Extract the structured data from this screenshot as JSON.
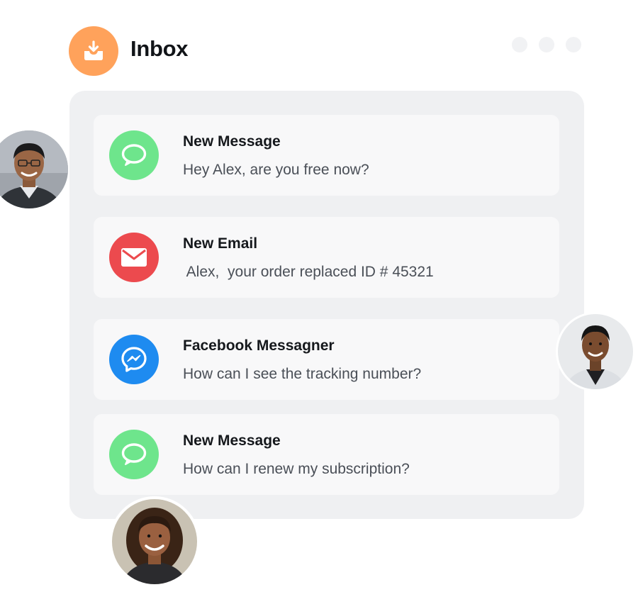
{
  "header": {
    "title": "Inbox",
    "icon": "inbox-download-icon",
    "accent": "#FFA25B"
  },
  "colors": {
    "panel_bg": "#EFF0F2",
    "card_bg": "#F8F8F9",
    "message_green": "#6EE58C",
    "email_red": "#EC4A4E",
    "messenger_blue": "#1E8BF0"
  },
  "messages": [
    {
      "icon": "chat-bubble-icon",
      "title": "New Message",
      "body": "Hey Alex, are you free now?"
    },
    {
      "icon": "envelope-icon",
      "title": "New Email",
      "body": " Alex,  your order replaced ID # 45321"
    },
    {
      "icon": "messenger-icon",
      "title": "Facebook Messagner",
      "body": "How can I see the tracking number?"
    },
    {
      "icon": "chat-bubble-icon",
      "title": "New Message",
      "body": "How can I renew my subscription?"
    }
  ]
}
